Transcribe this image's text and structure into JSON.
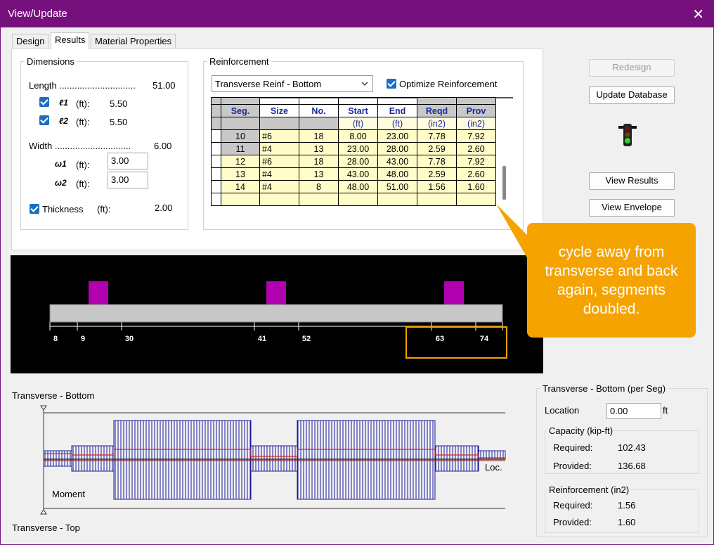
{
  "window": {
    "title": "View/Update",
    "close_glyph": "✕"
  },
  "tabs": [
    "Design",
    "Results",
    "Material Properties"
  ],
  "dimensions": {
    "label": "Dimensions",
    "length_label": "Length ..............................",
    "length_value": "51.00",
    "l1_symbol": "ℓ1",
    "l1_unit": "(ft):",
    "l1_value": "5.50",
    "l2_symbol": "ℓ2",
    "l2_unit": "(ft):",
    "l2_value": "5.50",
    "width_label": "Width ..............................",
    "width_value": "6.00",
    "w1_symbol": "ω1",
    "w1_unit": "(ft):",
    "w1_value": "3.00",
    "w2_symbol": "ω2",
    "w2_unit": "(ft):",
    "w2_value": "3.00",
    "thickness_label": "Thickness",
    "thickness_unit": "(ft):",
    "thickness_value": "2.00"
  },
  "reinforcement": {
    "label": "Reinforcement",
    "dropdown_value": "Transverse Reinf - Bottom",
    "optimize_label": "Optimize Reinforcement",
    "headers": [
      "Seg.",
      "Size",
      "No.",
      "Start",
      "End",
      "Reqd",
      "Prov"
    ],
    "units": [
      "",
      "",
      "(ft)",
      "(ft)",
      "(in2)",
      "(in2)"
    ],
    "rows": [
      [
        "10",
        "#6",
        "18",
        "8.00",
        "23.00",
        "7.78",
        "7.92"
      ],
      [
        "11",
        "#4",
        "13",
        "23.00",
        "28.00",
        "2.59",
        "2.60"
      ],
      [
        "12",
        "#6",
        "18",
        "28.00",
        "43.00",
        "7.78",
        "7.92"
      ],
      [
        "13",
        "#4",
        "13",
        "43.00",
        "48.00",
        "2.59",
        "2.60"
      ],
      [
        "14",
        "#4",
        "8",
        "48.00",
        "51.00",
        "1.56",
        "1.60"
      ]
    ]
  },
  "buttons": {
    "redesign": "Redesign",
    "update_database": "Update Database",
    "view_results": "View Results",
    "view_envelope": "View Envelope"
  },
  "callout_text": "cycle away from transverse and back again, segments doubled.",
  "beam": {
    "tick_labels": [
      "8",
      "9",
      "30",
      "41",
      "52",
      "63",
      "74"
    ]
  },
  "moment": {
    "top_label": "Transverse - Bottom",
    "bottom_label": "Transverse - Top",
    "moment_label": "Moment",
    "loc_label": "Loc."
  },
  "panel": {
    "title": "Transverse - Bottom (per Seg)",
    "location_label": "Location",
    "location_value": "0.00",
    "location_unit": "ft",
    "capacity_label": "Capacity (kip-ft)",
    "cap_required_label": "Required:",
    "cap_required_value": "102.43",
    "cap_provided_label": "Provided:",
    "cap_provided_value": "136.68",
    "reinf_label": "Reinforcement (in2)",
    "reinf_required_label": "Required:",
    "reinf_required_value": "1.56",
    "reinf_provided_label": "Provided:",
    "reinf_provided_value": "1.60"
  },
  "colors": {
    "title_bar": "#76107c",
    "accent_check": "#1a6fc4",
    "callout": "#f5a300",
    "highlight_box": "#f5a300",
    "load_block": "#b000b0",
    "diagram_hatch": "#1a1aa0",
    "diagram_line": "#e02020"
  }
}
